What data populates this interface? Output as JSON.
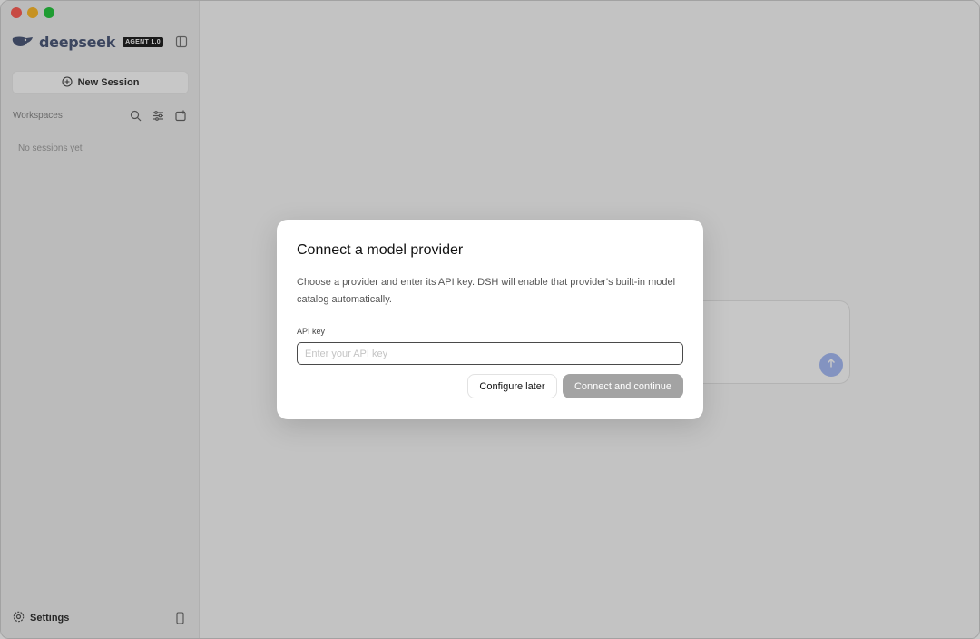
{
  "window": {
    "traffic_lights": [
      "close",
      "minimize",
      "zoom"
    ]
  },
  "sidebar": {
    "brand_name": "deepseek",
    "brand_badge": "AGENT 1.0",
    "new_session_label": "New Session",
    "workspaces_label": "Workspaces",
    "empty_label": "No sessions yet",
    "settings_label": "Settings",
    "icons": [
      "sidebar-toggle-icon",
      "search-icon",
      "filter-icon",
      "new-folder-icon",
      "gear-icon",
      "phone-icon"
    ]
  },
  "main": {
    "send_icon": "arrow-up-icon",
    "accent_color": "#a8bdf7"
  },
  "modal": {
    "title": "Connect a model provider",
    "description": "Choose a provider and enter its API key. DSH will enable that provider's built-in model catalog automatically.",
    "field_label": "API key",
    "input_placeholder": "Enter your API key",
    "input_value": "",
    "secondary_button": "Configure later",
    "primary_button": "Connect and continue",
    "primary_button_color": "#a3a3a3"
  }
}
